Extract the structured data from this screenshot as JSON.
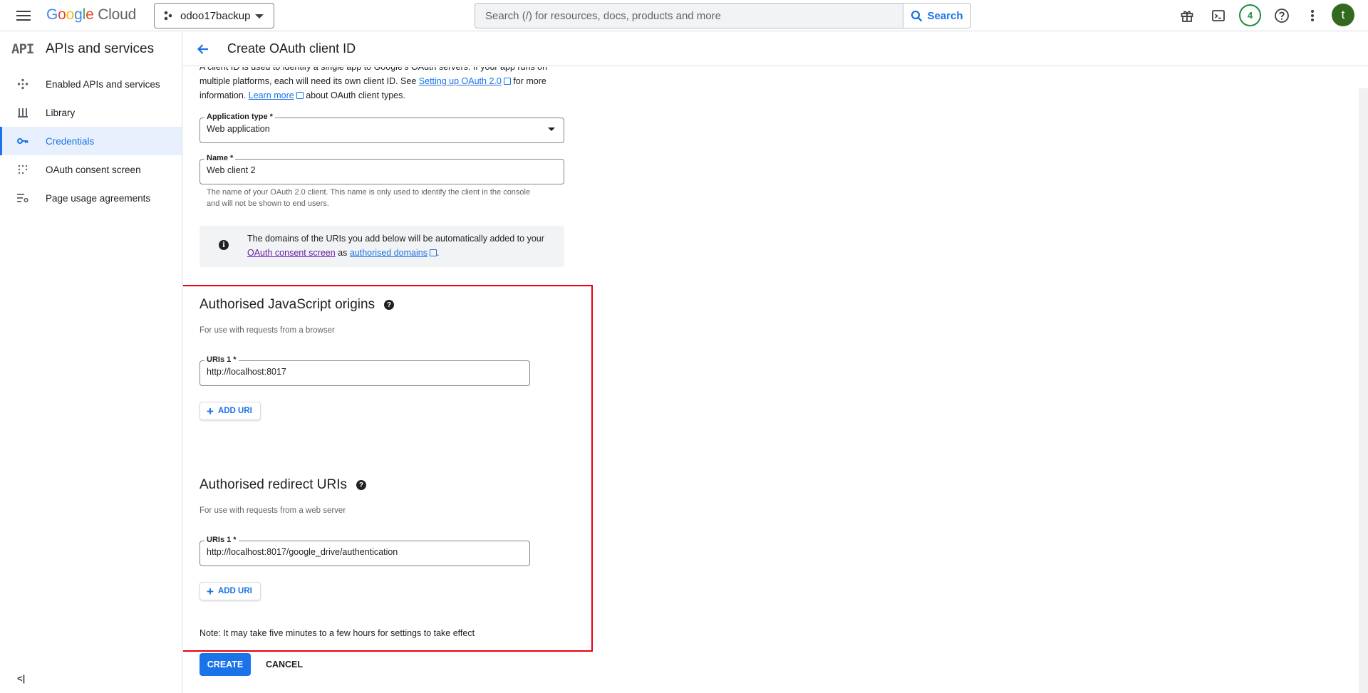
{
  "topbar": {
    "logo_letters": [
      "G",
      "o",
      "o",
      "g",
      "l",
      "e"
    ],
    "logo_suffix": "Cloud",
    "project_name": "odoo17backup",
    "search_placeholder": "Search (/) for resources, docs, products and more",
    "search_button": "Search",
    "notifications_count": "4",
    "avatar_letter": "t"
  },
  "sidebar": {
    "logo_text": "API",
    "title": "APIs and services",
    "items": [
      {
        "label": "Enabled APIs and services",
        "icon": "diamond-nav-icon"
      },
      {
        "label": "Library",
        "icon": "library-icon"
      },
      {
        "label": "Credentials",
        "icon": "key-icon",
        "active": true
      },
      {
        "label": "OAuth consent screen",
        "icon": "dots-grid-icon"
      },
      {
        "label": "Page usage agreements",
        "icon": "settings-list-icon"
      }
    ],
    "collapse_label": "<|"
  },
  "header": {
    "title": "Create OAuth client ID"
  },
  "intro": {
    "line1": "A client ID is used to identify a single app to Google's OAuth servers. If your app runs on",
    "line2_pre": "multiple platforms, each will need its own client ID. See ",
    "link1": "Setting up OAuth 2.0",
    "line2_post": " for more",
    "line3_pre": "information. ",
    "link2": "Learn more",
    "line3_post": " about OAuth client types."
  },
  "form": {
    "app_type_label": "Application type *",
    "app_type_value": "Web application",
    "name_label": "Name *",
    "name_value": "Web client 2",
    "name_hint": "The name of your OAuth 2.0 client. This name is only used to identify the client in the console and will not be shown to end users."
  },
  "info": {
    "text_pre": "The domains of the URIs you add below will be automatically added to your ",
    "link1": "OAuth consent screen",
    "text_mid": " as ",
    "link2": "authorised domains",
    "text_post": "."
  },
  "js_origins": {
    "title": "Authorised JavaScript origins",
    "subtitle": "For use with requests from a browser",
    "uri_label": "URIs 1 *",
    "uri_value": "http://localhost:8017",
    "add_label": "ADD URI"
  },
  "redirects": {
    "title": "Authorised redirect URIs",
    "subtitle": "For use with requests from a web server",
    "uri_label": "URIs 1 *",
    "uri_value": "http://localhost:8017/google_drive/authentication",
    "add_label": "ADD URI"
  },
  "note": "Note: It may take five minutes to a few hours for settings to take effect",
  "actions": {
    "create": "CREATE",
    "cancel": "CANCEL"
  },
  "colors": {
    "accent": "#1a73e8",
    "highlight_border": "#e8000b",
    "avatar_bg": "#33691e",
    "badge_green": "#1e8e3e"
  }
}
